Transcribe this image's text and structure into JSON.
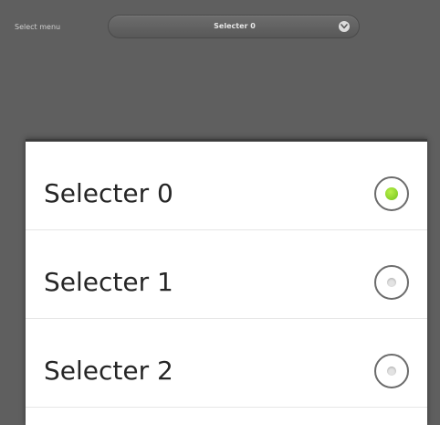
{
  "select": {
    "label": "Select menu",
    "value": "Selecter 0",
    "chevron_icon": "chevron-down-icon"
  },
  "dialog": {
    "options": [
      {
        "label": "Selecter 0",
        "selected": true
      },
      {
        "label": "Selecter 1",
        "selected": false
      },
      {
        "label": "Selecter 2",
        "selected": false
      }
    ]
  },
  "colors": {
    "background": "#5f5f5f",
    "selected_accent": "#73c21c"
  }
}
